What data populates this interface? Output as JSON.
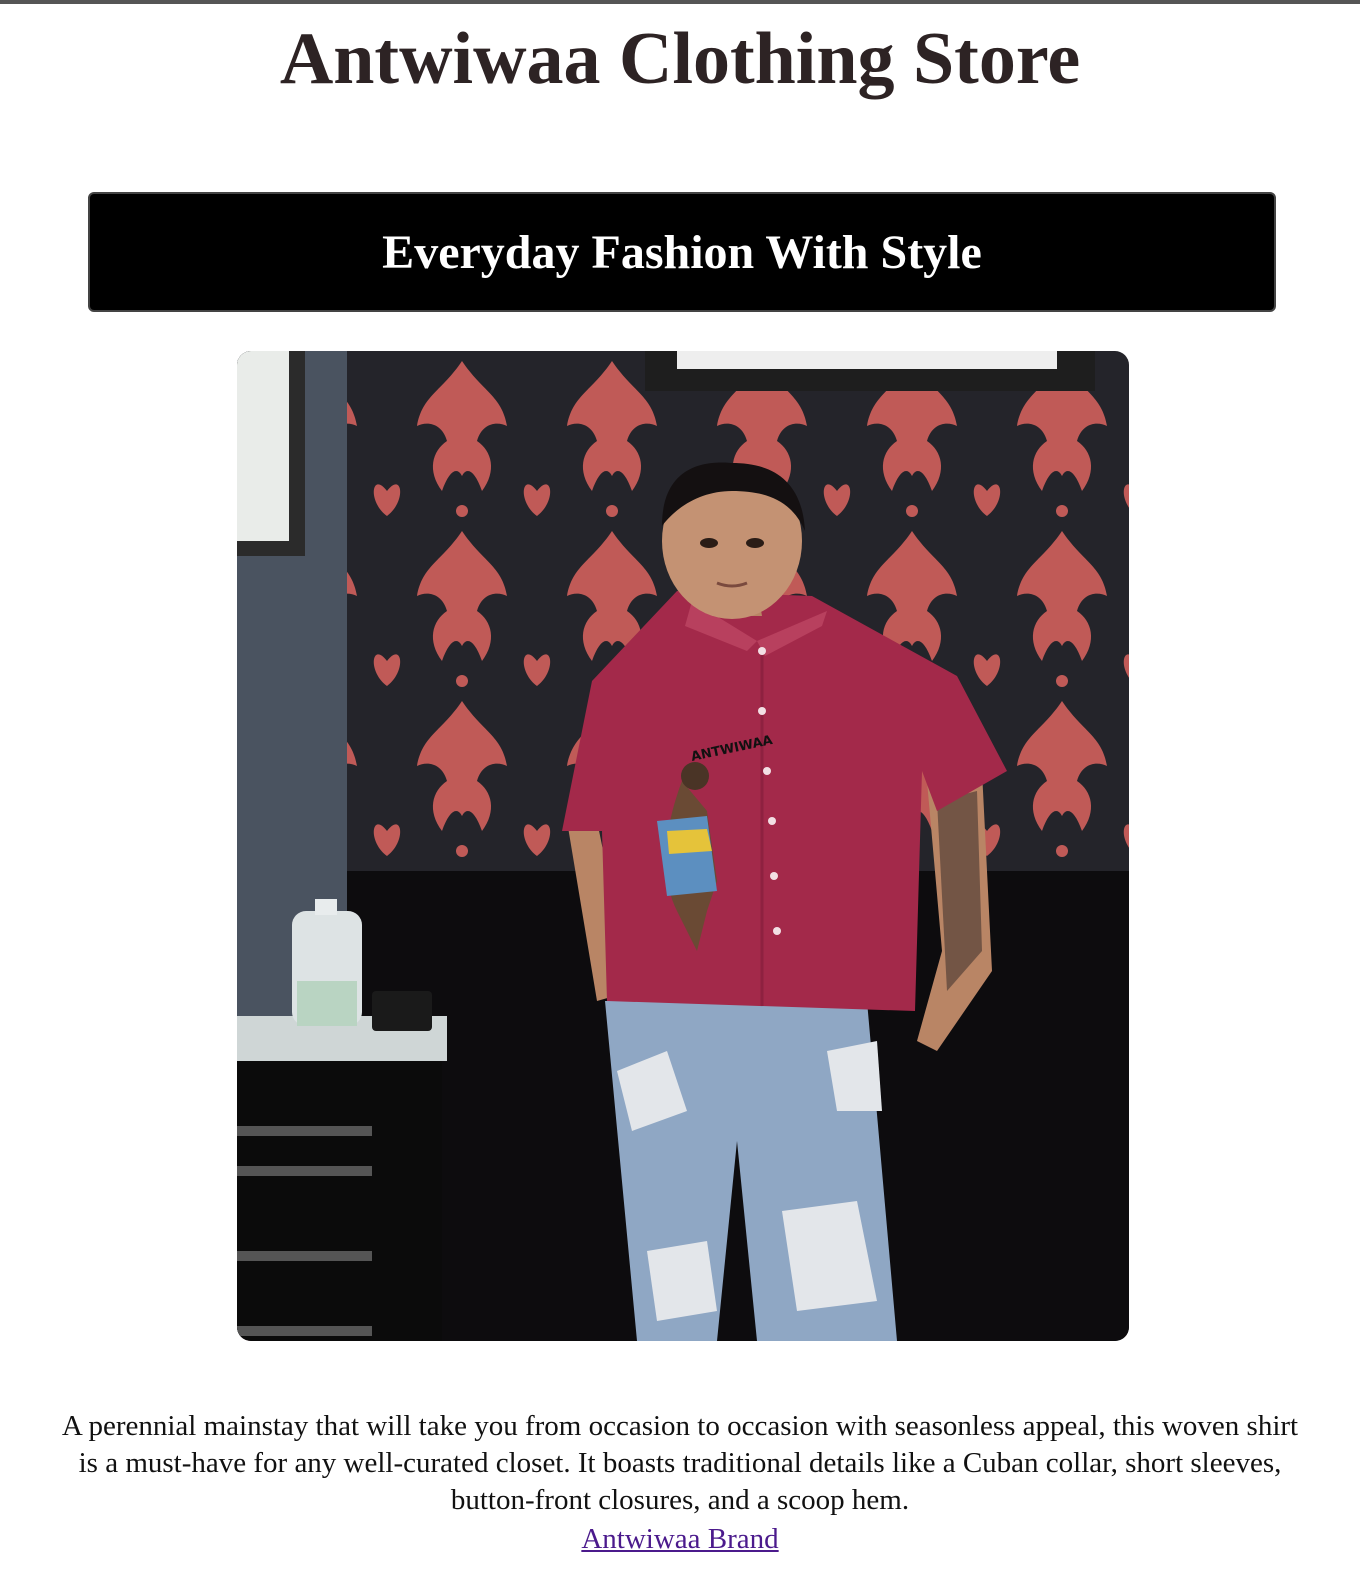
{
  "header": {
    "title": "Antwiwaa Clothing Store"
  },
  "banner": {
    "heading": "Everyday Fashion With Style"
  },
  "product": {
    "photo_subject": "model-wearing-shirt-photo",
    "shirt_print_text": "ANTWIWAA",
    "shirt_color": "#a3294a",
    "description": "A perennial mainstay that will take you from occasion to occasion with seasonless appeal, this woven shirt is a must-have for any well-curated closet. It boasts traditional details like a Cuban collar, short sleeves, button-front closures, and a scoop hem.",
    "link_label": "Antwiwaa Brand"
  },
  "colors": {
    "title": "#2d2324",
    "banner_bg": "#000000",
    "banner_text": "#ffffff",
    "link": "#4b1a8c"
  }
}
